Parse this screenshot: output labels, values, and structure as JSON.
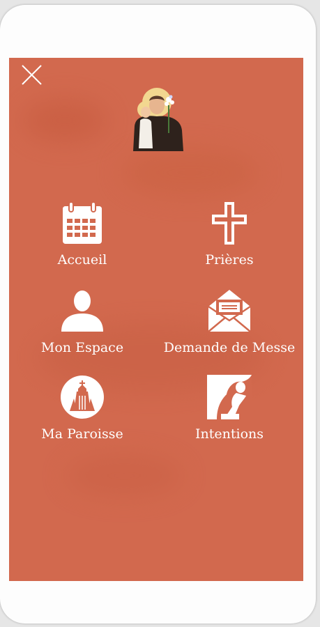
{
  "menu": {
    "close_icon": "close-icon",
    "logo": "saint-anthony-logo",
    "items": [
      {
        "label": "Accueil",
        "icon": "calendar-icon"
      },
      {
        "label": "Prières",
        "icon": "cross-icon"
      },
      {
        "label": "Mon Espace",
        "icon": "user-icon"
      },
      {
        "label": "Demande de Messe",
        "icon": "envelope-icon"
      },
      {
        "label": "Ma Paroisse",
        "icon": "church-icon"
      },
      {
        "label": "Intentions",
        "icon": "praying-figure-icon"
      }
    ]
  },
  "colors": {
    "menu_background": "#d2694e",
    "text": "#ffffff",
    "frame": "#fdfdfd"
  }
}
